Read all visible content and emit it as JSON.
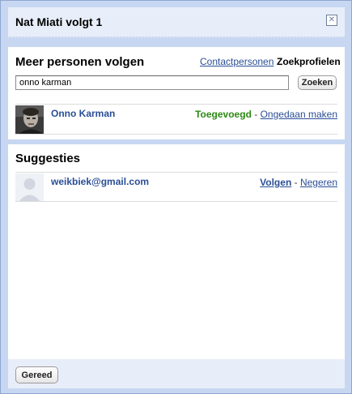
{
  "dialog": {
    "title": "Nat Miati volgt 1",
    "close_symbol": "✕"
  },
  "follow_more": {
    "heading": "Meer personen volgen",
    "tab_contacts": "Contactpersonen",
    "tab_profiles": "Zoekprofielen",
    "search_value": "onno karman",
    "search_button": "Zoeken",
    "result": {
      "name": "Onno Karman",
      "status": "Toegevoegd",
      "separator": "-",
      "undo": "Ongedaan maken"
    }
  },
  "suggestions": {
    "heading": "Suggesties",
    "items": [
      {
        "name": "weikbiek@gmail.com",
        "follow": "Volgen",
        "separator": "-",
        "ignore": "Negeren"
      }
    ]
  },
  "footer": {
    "done_button": "Gereed"
  },
  "colors": {
    "link": "#2a4e96",
    "added": "#2b8a12",
    "frame": "#c7d7f2"
  },
  "icons": {
    "close": "close-icon",
    "result_avatar": "user-photo",
    "suggestion_avatar": "default-avatar-icon"
  }
}
